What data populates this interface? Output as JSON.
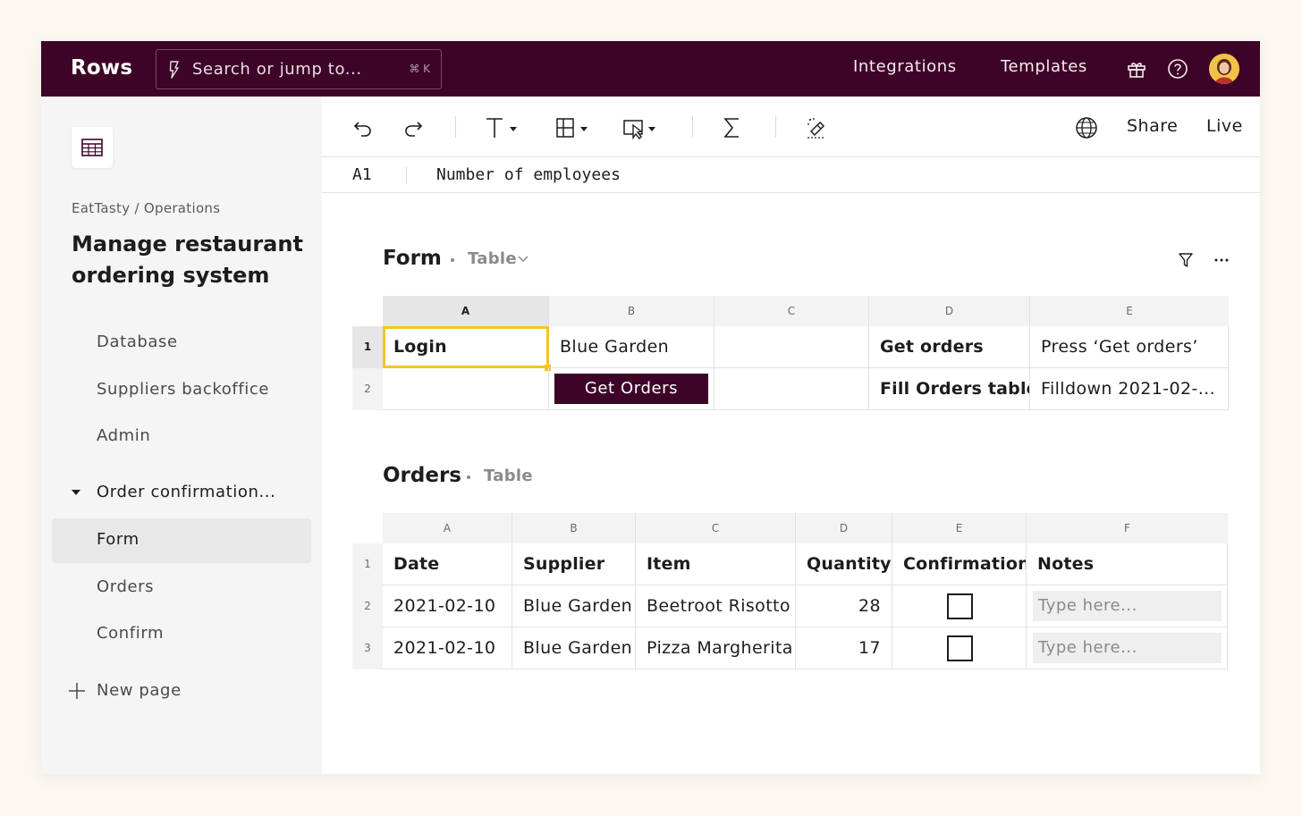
{
  "app": {
    "logo": "Rows",
    "search_placeholder": "Search or jump to...",
    "search_shortcut": "⌘ K",
    "nav": {
      "integrations": "Integrations",
      "templates": "Templates"
    },
    "icons": [
      "bolt-icon",
      "gift-icon",
      "help-icon",
      "avatar"
    ]
  },
  "sidebar": {
    "breadcrumb": "EatTasty / Operations",
    "title": "Manage restaurant ordering system",
    "items": [
      {
        "label": "Database"
      },
      {
        "label": "Suppliers backoffice"
      },
      {
        "label": "Admin"
      },
      {
        "label": "Order confirmation..."
      },
      {
        "label": "Form"
      },
      {
        "label": "Orders"
      },
      {
        "label": "Confirm"
      }
    ],
    "new_page": "New page",
    "active_item": "Form"
  },
  "toolbar": {
    "share": "Share",
    "live": "Live",
    "icons": [
      "undo-icon",
      "redo-icon",
      "text-format-icon",
      "layout-icon",
      "action-icon",
      "sum-icon",
      "magic-icon",
      "globe-icon"
    ]
  },
  "formula_bar": {
    "cell_ref": "A1",
    "value": "Number of employees"
  },
  "form_table": {
    "title": "Form",
    "kind": "Table",
    "columns": [
      "A",
      "B",
      "C",
      "D",
      "E"
    ],
    "rows": [
      "1",
      "2"
    ],
    "cells": {
      "a1": "Login",
      "b1": "Blue Garden",
      "c1": "",
      "d1": "Get orders",
      "e1": "Press ‘Get orders’",
      "a2": "",
      "b2_button": "Get Orders",
      "c2": "",
      "d2": "Fill Orders table",
      "e2": "Filldown 2021-02-..."
    },
    "selected_cell": "A1"
  },
  "orders_table": {
    "title": "Orders",
    "kind": "Table",
    "columns": [
      "A",
      "B",
      "C",
      "D",
      "E",
      "F"
    ],
    "rows": [
      "1",
      "2",
      "3"
    ],
    "headers": [
      "Date",
      "Supplier",
      "Item",
      "Quantity",
      "Confirmation",
      "Notes"
    ],
    "data": [
      {
        "date": "2021-02-10",
        "supplier": "Blue Garden",
        "item": "Beetroot Risotto",
        "quantity": "28",
        "confirmed": false,
        "notes_placeholder": "Type here..."
      },
      {
        "date": "2021-02-10",
        "supplier": "Blue Garden",
        "item": "Pizza Margherita",
        "quantity": "17",
        "confirmed": false,
        "notes_placeholder": "Type here..."
      }
    ]
  },
  "colors": {
    "brand": "#3e0428",
    "selection": "#f7c325",
    "background": "#fbf8f1"
  }
}
